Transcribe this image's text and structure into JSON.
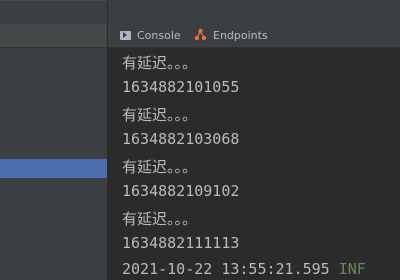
{
  "tabs": [
    {
      "label": "Console",
      "icon": "console-icon"
    },
    {
      "label": "Endpoints",
      "icon": "endpoints-icon"
    }
  ],
  "console": {
    "lines": [
      "有延迟。。。",
      "1634882101055",
      "有延迟。。。",
      "1634882103068",
      "有延迟。。。",
      "1634882109102",
      "有延迟。。。",
      "1634882111113"
    ],
    "last_line": {
      "timestamp": "2021-10-22 13:55:21.595",
      "level": "INF"
    }
  },
  "colors": {
    "background": "#2b2b2b",
    "panel": "#3c3f41",
    "selection": "#4b6eaf",
    "text": "#bbbbbb",
    "info_level": "#6a8759"
  }
}
